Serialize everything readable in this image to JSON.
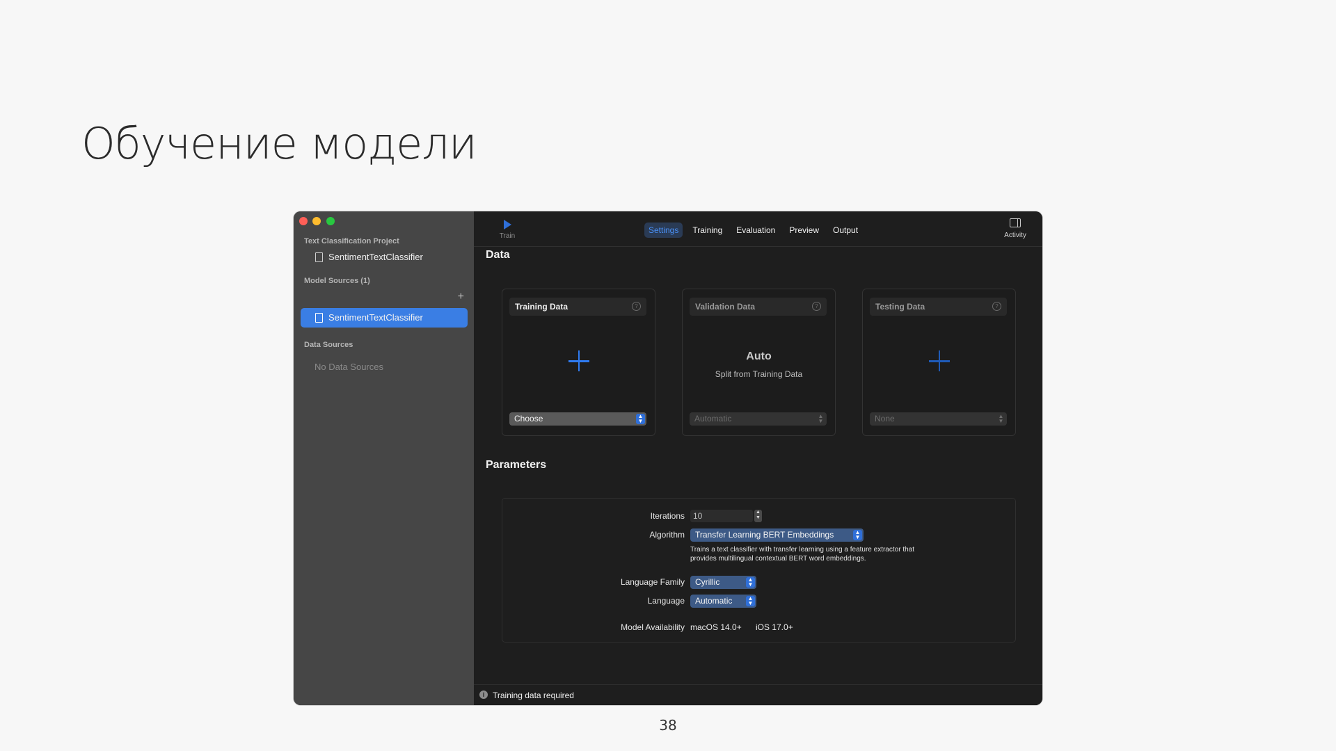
{
  "slide": {
    "title": "Обучение модели",
    "page_number": "38"
  },
  "sidebar": {
    "project_section": "Text Classification Project",
    "project_item": "SentimentTextClassifier",
    "model_sources_section": "Model Sources (1)",
    "model_source_item": "SentimentTextClassifier",
    "add_symbol": "+",
    "data_sources_section": "Data Sources",
    "data_sources_empty": "No Data Sources"
  },
  "toolbar": {
    "train_label": "Train",
    "tabs": [
      {
        "label": "Settings",
        "active": true
      },
      {
        "label": "Training",
        "active": false
      },
      {
        "label": "Evaluation",
        "active": false
      },
      {
        "label": "Preview",
        "active": false
      },
      {
        "label": "Output",
        "active": false
      }
    ],
    "activity_label": "Activity"
  },
  "data_section": {
    "title": "Data",
    "training": {
      "title": "Training Data",
      "select": "Choose"
    },
    "validation": {
      "title": "Validation Data",
      "big": "Auto",
      "sub": "Split from Training Data",
      "select": "Automatic"
    },
    "testing": {
      "title": "Testing Data",
      "select": "None"
    },
    "help_symbol": "?"
  },
  "parameters": {
    "title": "Parameters",
    "iterations_label": "Iterations",
    "iterations_value": "10",
    "algorithm_label": "Algorithm",
    "algorithm_value": "Transfer Learning BERT Embeddings",
    "algorithm_description": "Trains a text classifier with transfer learning using a feature extractor that provides multilingual contextual BERT word embeddings.",
    "language_family_label": "Language Family",
    "language_family_value": "Cyrillic",
    "language_label": "Language",
    "language_value": "Automatic",
    "availability_label": "Model Availability",
    "availability_macos": "macOS 14.0+",
    "availability_ios": "iOS 17.0+"
  },
  "status": {
    "info_symbol": "i",
    "text": "Training data required"
  },
  "colors": {
    "accent": "#3a7ee4",
    "window_bg": "#1e1e1e",
    "sidebar_bg": "#464646"
  }
}
